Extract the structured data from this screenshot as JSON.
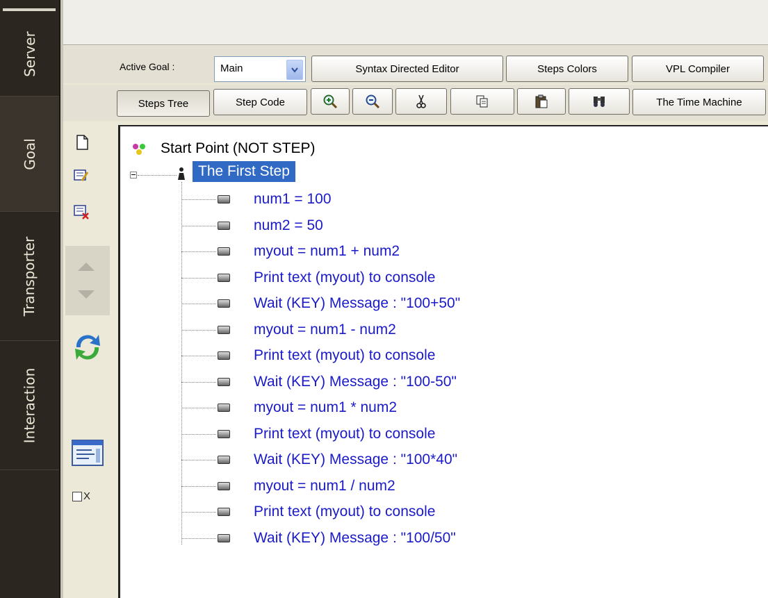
{
  "side_tabs": [
    {
      "label": "Server"
    },
    {
      "label": "Goal"
    },
    {
      "label": "Transporter"
    },
    {
      "label": "Interaction"
    }
  ],
  "toolbar1": {
    "active_goal_label": "Active Goal :",
    "goal_value": "Main",
    "syntax_editor": "Syntax Directed Editor",
    "steps_colors": "Steps Colors",
    "vpl_compiler": "VPL Compiler"
  },
  "toolbar2": {
    "steps_tree": "Steps Tree",
    "step_code": "Step Code",
    "time_machine": "The Time Machine"
  },
  "side_panel": {
    "checkbox_label": "X"
  },
  "tree": {
    "root": "Start Point (NOT STEP)",
    "step": "The First Step",
    "items": [
      "num1 = 100",
      "num2 = 50",
      "myout = num1 + num2",
      "Print text (myout) to console",
      "Wait (KEY) Message : \"100+50\"",
      "myout = num1 - num2",
      "Print text (myout) to console",
      "Wait (KEY) Message : \"100-50\"",
      "myout = num1 * num2",
      "Print text (myout) to console",
      "Wait (KEY) Message : \"100*40\"",
      "myout = num1 / num2",
      "Print text (myout) to console",
      "Wait (KEY) Message : \"100/50\""
    ]
  },
  "icons": {
    "zoom_in": "zoom-in-icon",
    "zoom_out": "zoom-out-icon",
    "cut": "cut-icon",
    "copy": "copy-icon",
    "paste": "paste-icon",
    "find": "find-icon"
  }
}
